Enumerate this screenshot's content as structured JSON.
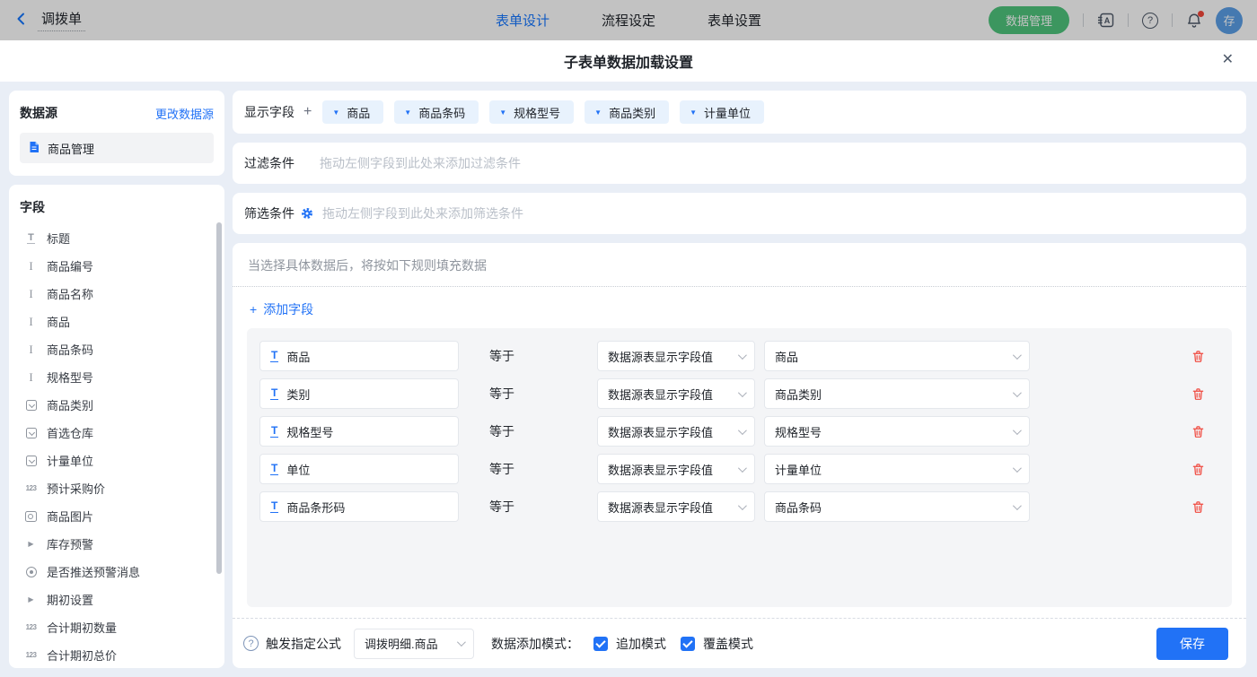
{
  "topbar": {
    "form_name": "调拨单",
    "tabs": [
      {
        "label": "表单设计",
        "active": true
      },
      {
        "label": "流程设定",
        "active": false
      },
      {
        "label": "表单设置",
        "active": false
      }
    ],
    "data_manage_button": "数据管理",
    "avatar_text": "存"
  },
  "modal": {
    "title": "子表单数据加载设置",
    "close_icon": "✕",
    "datasource": {
      "title": "数据源",
      "change_link": "更改数据源",
      "items": [
        {
          "label": "商品管理",
          "icon": "document-icon"
        }
      ]
    },
    "fields_panel": {
      "title": "字段",
      "items": [
        {
          "label": "标题",
          "icon": "title-icon"
        },
        {
          "label": "商品编号",
          "icon": "text-icon"
        },
        {
          "label": "商品名称",
          "icon": "text-icon"
        },
        {
          "label": "商品",
          "icon": "text-icon"
        },
        {
          "label": "商品条码",
          "icon": "text-icon"
        },
        {
          "label": "规格型号",
          "icon": "text-icon"
        },
        {
          "label": "商品类别",
          "icon": "select-icon"
        },
        {
          "label": "首选仓库",
          "icon": "select-icon"
        },
        {
          "label": "计量单位",
          "icon": "select-icon"
        },
        {
          "label": "预计采购价",
          "icon": "number-icon"
        },
        {
          "label": "商品图片",
          "icon": "image-icon"
        },
        {
          "label": "库存预警",
          "icon": "group-caret-icon"
        },
        {
          "label": "是否推送预警消息",
          "icon": "radio-icon"
        },
        {
          "label": "期初设置",
          "icon": "group-caret-icon"
        },
        {
          "label": "合计期初数量",
          "icon": "number-icon"
        },
        {
          "label": "合计期初总价",
          "icon": "number-icon"
        }
      ],
      "number_icon_text": "123",
      "caret_icon_text": "▶",
      "title_icon_text": "T",
      "text_icon_text": "I"
    },
    "display_fields": {
      "label": "显示字段",
      "plus_icon": "+",
      "chip_caret": "▼",
      "chips": [
        "商品",
        "商品条码",
        "规格型号",
        "商品类别",
        "计量单位"
      ]
    },
    "filter": {
      "label": "过滤条件",
      "placeholder": "拖动左侧字段到此处来添加过滤条件"
    },
    "screen": {
      "label": "筛选条件",
      "placeholder": "拖动左侧字段到此处来添加筛选条件"
    },
    "rules": {
      "hint": "当选择具体数据后，将按如下规则填充数据",
      "plus_icon": "+",
      "add_field_label": "添加字段",
      "operator": "等于",
      "target_icon_text": "T",
      "rows": [
        {
          "target": "商品",
          "source_type": "数据源表显示字段值",
          "source_field": "商品"
        },
        {
          "target": "类别",
          "source_type": "数据源表显示字段值",
          "source_field": "商品类别"
        },
        {
          "target": "规格型号",
          "source_type": "数据源表显示字段值",
          "source_field": "规格型号"
        },
        {
          "target": "单位",
          "source_type": "数据源表显示字段值",
          "source_field": "计量单位"
        },
        {
          "target": "商品条形码",
          "source_type": "数据源表显示字段值",
          "source_field": "商品条码"
        }
      ]
    },
    "footer": {
      "help_icon_text": "?",
      "trigger_label": "触发指定公式",
      "trigger_value": "调拨明细.商品",
      "mode_label": "数据添加模式：",
      "modes": [
        {
          "label": "追加模式",
          "checked": true
        },
        {
          "label": "覆盖模式",
          "checked": true
        }
      ],
      "save_label": "保存"
    }
  },
  "colors": {
    "accent_blue": "#2172F6",
    "active_tab_blue": "#1677FF",
    "chip_bg": "#E8F2FD",
    "green_button": "#4FC57E",
    "danger_red": "#F0483E",
    "body_bg": "#E9EEF6",
    "panel_gray": "#F4F5F7",
    "avatar_blue": "#5B9FE8",
    "notification_dot": "#F5483B"
  }
}
